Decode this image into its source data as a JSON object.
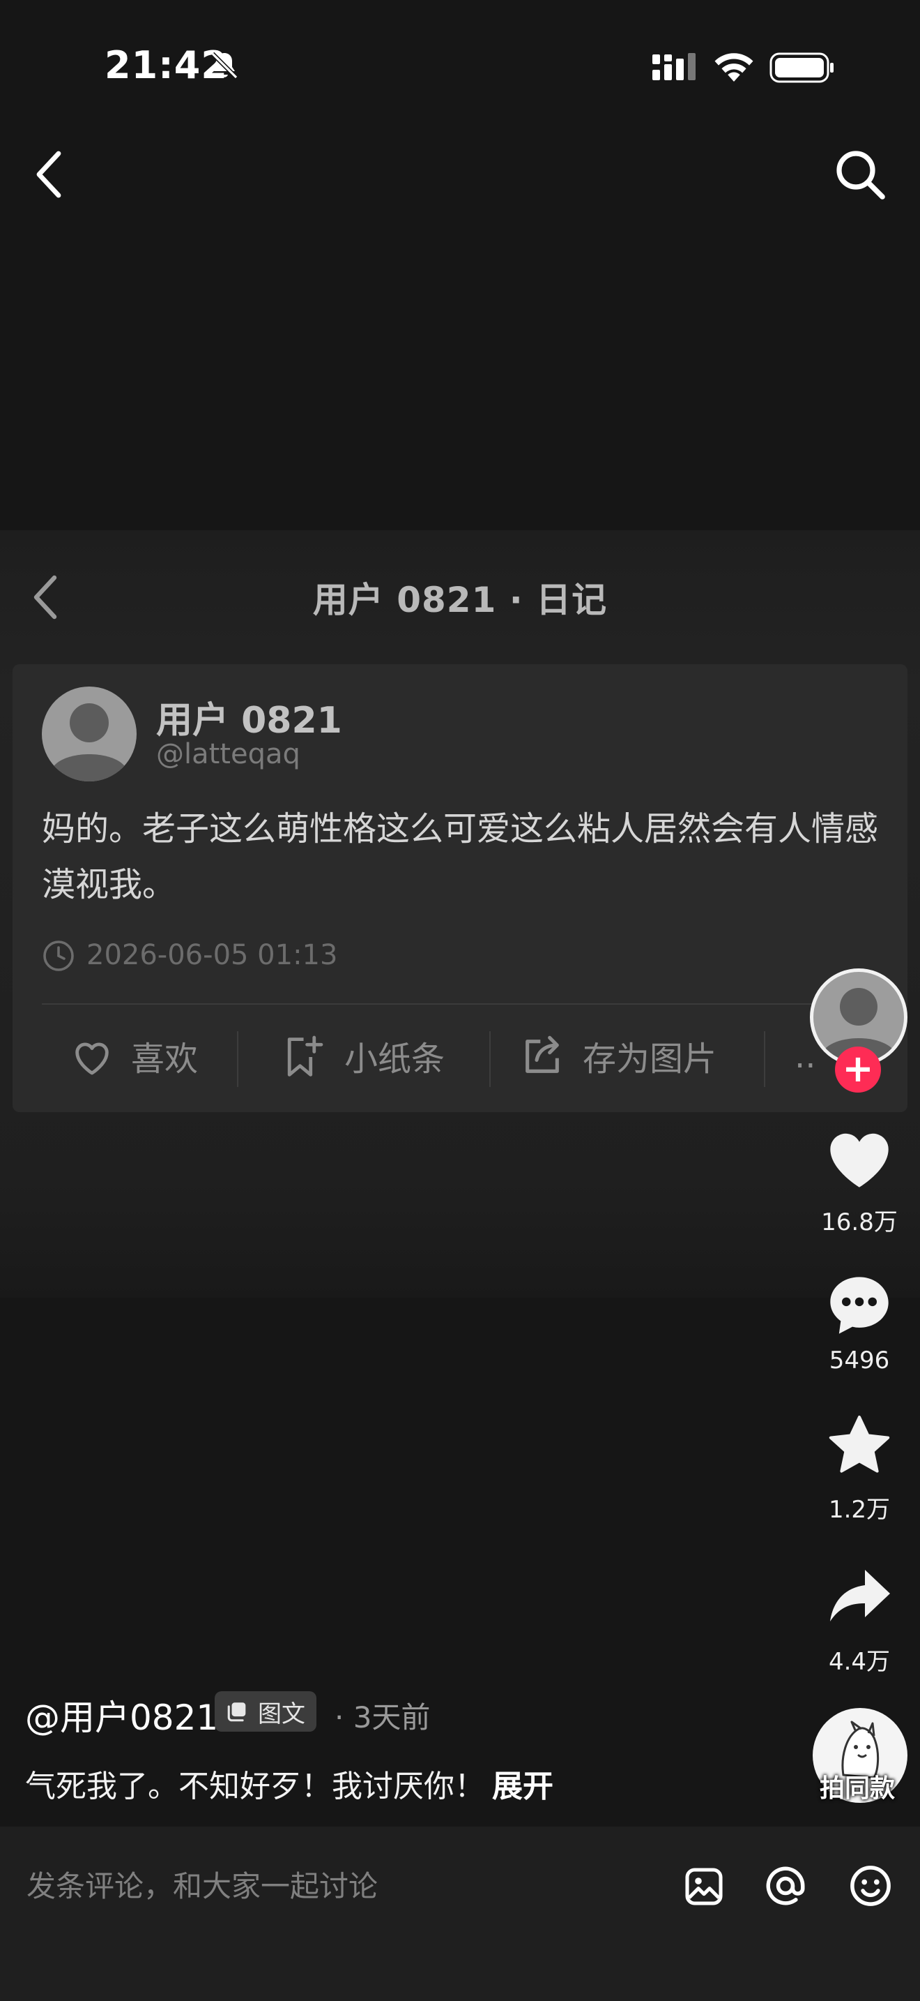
{
  "status_bar": {
    "time": "21:42",
    "icons": [
      "bell-muted-icon",
      "cellular-signal-icon",
      "wifi-icon",
      "battery-icon"
    ]
  },
  "top_bar": {
    "back_icon": "chevron-left-icon",
    "search_icon": "search-icon"
  },
  "post_image": {
    "header_title": "用户 0821 · 日记",
    "card": {
      "name": "用户 0821",
      "handle": "@latteqaq",
      "body": "妈的。老子这么萌性格这么可爱这么粘人居然会有人情感漠视我。",
      "timestamp": "2026-06-05 01:13",
      "actions": [
        {
          "label": "喜欢",
          "icon": "heart-outline-icon"
        },
        {
          "label": "小纸条",
          "icon": "bookmark-plus-icon"
        },
        {
          "label": "存为图片",
          "icon": "share-box-icon"
        },
        {
          "label": "··",
          "icon": "more-icon"
        }
      ]
    }
  },
  "right_rail": {
    "follow_symbol": "+",
    "like_count": "16.8万",
    "comment_count": "5496",
    "favorite_count": "1.2万",
    "share_count": "4.4万",
    "music_label": "拍同款"
  },
  "caption": {
    "author": "@用户0821",
    "type_badge": "图文",
    "age": "· 3天前",
    "text": "气死我了。不知好歹！我讨厌你！",
    "expand": "展开"
  },
  "comment_bar": {
    "placeholder": "发条评论，和大家一起讨论",
    "icons": [
      "image-icon",
      "at-icon",
      "emoji-icon"
    ]
  },
  "colors": {
    "background": "#161616",
    "card": "#2b2b2b",
    "accent": "#fe2c55"
  }
}
